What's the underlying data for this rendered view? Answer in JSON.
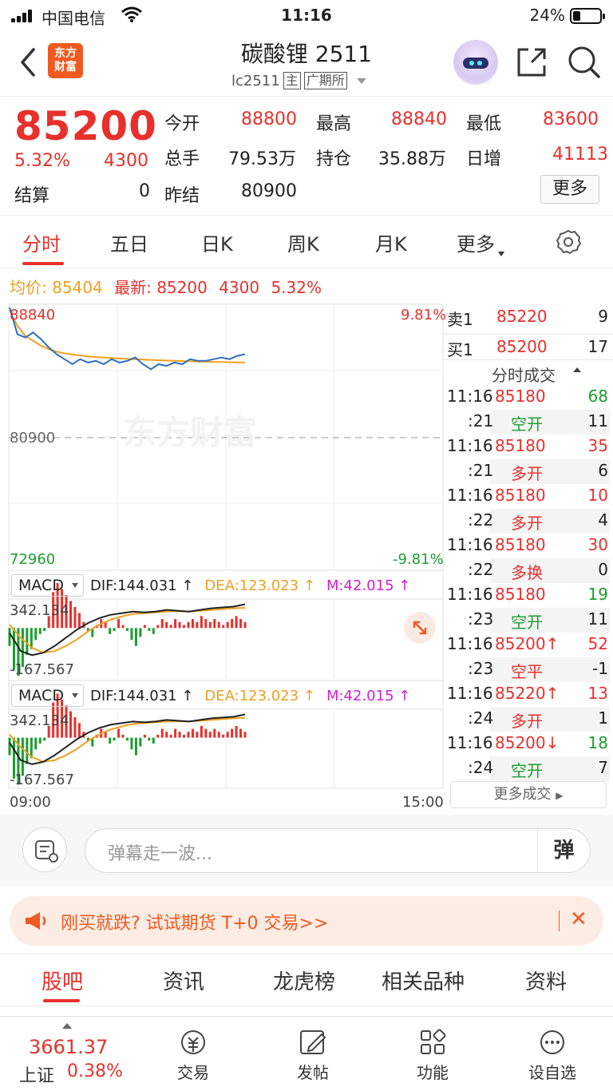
{
  "status_bar": {
    "carrier": "中国电信",
    "time": "11:16",
    "battery": "24%"
  },
  "nav": {
    "logo_text": "东方财富",
    "title": "碳酸锂 2511",
    "code": "lc2511",
    "tag_main": "主",
    "exchange": "广期所"
  },
  "quote": {
    "price": "85200",
    "change_pct": "5.32%",
    "change": "4300",
    "settle_label": "结算",
    "settle_value": "0",
    "open_label": "今开",
    "open_value": "88800",
    "high_label": "最高",
    "high_value": "88840",
    "low_label": "最低",
    "low_value": "83600",
    "volume_label": "总手",
    "volume_value": "79.53万",
    "oi_label": "持仓",
    "oi_value": "35.88万",
    "daily_inc_label": "日增",
    "daily_inc_value": "41113",
    "prev_settle_label": "昨结",
    "prev_settle_value": "80900",
    "more_label": "更多"
  },
  "tabs": [
    "分时",
    "五日",
    "日K",
    "周K",
    "月K",
    "更多"
  ],
  "info": {
    "avg_label": "均价:",
    "avg_value": "85404",
    "latest_label": "最新:",
    "latest_value": "85200",
    "change": "4300",
    "pct": "5.32%"
  },
  "chart_labels": {
    "top_price": "88840",
    "top_pct": "9.81%",
    "mid_price": "80900",
    "bottom_price": "72960",
    "bottom_pct": "-9.81%",
    "watermark": "东方财富",
    "time_start": "09:00",
    "time_end": "15:00"
  },
  "macd": {
    "name": "MACD",
    "dif": "DIF:144.031 ↑",
    "dea": "DEA:123.023 ↑",
    "m": "M:42.015 ↑",
    "top": "342.134",
    "bottom": "-167.567"
  },
  "chart_data": {
    "type": "line",
    "series": [
      {
        "name": "最新",
        "values": [
          88700,
          87100,
          86900,
          87200,
          86800,
          86300,
          85900,
          85600,
          85300,
          85600,
          85400,
          85500,
          85300,
          85600,
          85400,
          85500,
          85700,
          85300,
          85000,
          85300,
          85200,
          85400,
          85300,
          85600,
          85500,
          85500,
          85600,
          85700,
          85600,
          85800,
          85900
        ]
      },
      {
        "name": "均价",
        "values": [
          88500,
          87600,
          87000,
          86700,
          86400,
          86200,
          86050,
          85950,
          85880,
          85820,
          85770,
          85730,
          85700,
          85670,
          85640,
          85620,
          85600,
          85580,
          85560,
          85540,
          85520,
          85505,
          85490,
          85475,
          85460,
          85450,
          85440,
          85430,
          85420,
          85410,
          85404
        ]
      }
    ],
    "ylim": [
      72960,
      88840
    ],
    "reference": 80900,
    "colors": {
      "price": "#2e6fbf",
      "avg": "#f0a020"
    },
    "macd_hist": [
      -60,
      -140,
      -160,
      -130,
      -90,
      -70,
      -40,
      -20,
      -10,
      40,
      120,
      150,
      130,
      110,
      90,
      70,
      50,
      20,
      -10,
      -30,
      10,
      30,
      20,
      -20,
      -10,
      30,
      10,
      -10,
      -40,
      -60,
      -30,
      10,
      -10,
      -20,
      10,
      30,
      20,
      10,
      30,
      20,
      10,
      20,
      30,
      20,
      40,
      30,
      20,
      30,
      20,
      10,
      20,
      30,
      40,
      30,
      20
    ],
    "macd_dif": [
      -30,
      -140,
      -165,
      -150,
      -110,
      -60,
      -10,
      30,
      60,
      80,
      90,
      100,
      95,
      100,
      110,
      105,
      100,
      110,
      120,
      125,
      130,
      144
    ],
    "macd_dea": [
      20,
      -60,
      -120,
      -150,
      -140,
      -110,
      -70,
      -20,
      20,
      50,
      70,
      85,
      90,
      95,
      100,
      102,
      100,
      105,
      110,
      115,
      120,
      123
    ]
  },
  "book": {
    "ask_label": "卖1",
    "ask_price": "85220",
    "ask_vol": "9",
    "bid_label": "买1",
    "bid_price": "85200",
    "bid_vol": "17",
    "ticks_title": "分时成交",
    "ticks": [
      {
        "time": "11:16",
        "price": "85180",
        "vol": "68",
        "vol_color": "green"
      },
      {
        "time": ":21",
        "type": "空开",
        "vol": "11",
        "type_color": "green"
      },
      {
        "time": "11:16",
        "price": "85180",
        "vol": "35",
        "vol_color": "red"
      },
      {
        "time": ":21",
        "type": "多开",
        "vol": "6",
        "type_color": "red"
      },
      {
        "time": "11:16",
        "price": "85180",
        "vol": "10",
        "vol_color": "red"
      },
      {
        "time": ":22",
        "type": "多开",
        "vol": "4",
        "type_color": "red"
      },
      {
        "time": "11:16",
        "price": "85180",
        "vol": "30",
        "vol_color": "red"
      },
      {
        "time": ":22",
        "type": "多换",
        "vol": "0",
        "type_color": "red"
      },
      {
        "time": "11:16",
        "price": "85180",
        "vol": "19",
        "vol_color": "green"
      },
      {
        "time": ":23",
        "type": "空开",
        "vol": "11",
        "type_color": "green"
      },
      {
        "time": "11:16",
        "price": "85200↑",
        "vol": "52",
        "vol_color": "red"
      },
      {
        "time": ":23",
        "type": "空平",
        "vol": "-1",
        "type_color": "red"
      },
      {
        "time": "11:16",
        "price": "85220↑",
        "vol": "13",
        "vol_color": "red"
      },
      {
        "time": ":24",
        "type": "多开",
        "vol": "1",
        "type_color": "red"
      },
      {
        "time": "11:16",
        "price": "85200↓",
        "vol": "18",
        "vol_color": "green"
      },
      {
        "time": ":24",
        "type": "空开",
        "vol": "7",
        "type_color": "green"
      }
    ],
    "more_deals": "更多成交"
  },
  "barrage": {
    "placeholder": "弹幕走一波...",
    "button": "弹"
  },
  "promo": {
    "text": "刚买就跌? 试试期货 T+0 交易>>",
    "close": "✕"
  },
  "bottom_tabs": [
    "股吧",
    "资讯",
    "龙虎榜",
    "相关品种",
    "资料"
  ],
  "footer": {
    "index_value": "3661.37",
    "index_name": "上证",
    "index_change": "0.38%",
    "items": [
      "交易",
      "发帖",
      "功能",
      "设自选"
    ]
  }
}
